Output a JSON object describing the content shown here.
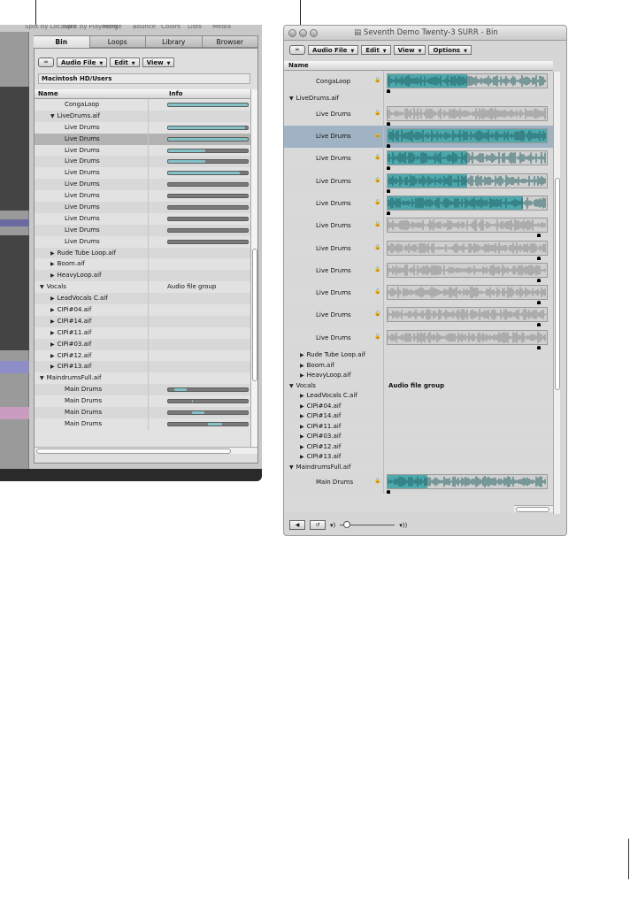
{
  "left_panel": {
    "top_menu": [
      "Split by Locators",
      "Split by Playhead",
      "Merge",
      "Bounce",
      "Colors",
      "Lists",
      "Media"
    ],
    "tabs": [
      "Bin",
      "Loops",
      "Library",
      "Browser"
    ],
    "toolbar": {
      "link_icon": "link-icon",
      "menus": [
        "Audio File",
        "Edit",
        "View"
      ]
    },
    "path": "Macintosh HD/Users",
    "columns": {
      "name": "Name",
      "info": "Info"
    },
    "rows": [
      {
        "name": "CongaLoop",
        "indent": 2,
        "tri": "",
        "bar": 1.0,
        "fill": 1.0
      },
      {
        "name": "LiveDrums.aif",
        "indent": 1,
        "tri": "open"
      },
      {
        "name": "Live Drums",
        "indent": 2,
        "tri": "",
        "bar": 1.0,
        "fill": 0.97
      },
      {
        "name": "Live Drums",
        "indent": 2,
        "tri": "",
        "bar": 1.0,
        "fill": 1.0,
        "selected": true
      },
      {
        "name": "Live Drums",
        "indent": 2,
        "tri": "",
        "bar": 1.0,
        "fill": 0.47
      },
      {
        "name": "Live Drums",
        "indent": 2,
        "tri": "",
        "bar": 1.0,
        "fill": 0.47
      },
      {
        "name": "Live Drums",
        "indent": 2,
        "tri": "",
        "bar": 1.0,
        "fill": 0.9
      },
      {
        "name": "Live Drums",
        "indent": 2,
        "tri": "",
        "bar": 1.0,
        "fill": 0
      },
      {
        "name": "Live Drums",
        "indent": 2,
        "tri": "",
        "bar": 1.0,
        "fill": 0
      },
      {
        "name": "Live Drums",
        "indent": 2,
        "tri": "",
        "bar": 1.0,
        "fill": 0
      },
      {
        "name": "Live Drums",
        "indent": 2,
        "tri": "",
        "bar": 1.0,
        "fill": 0
      },
      {
        "name": "Live Drums",
        "indent": 2,
        "tri": "",
        "bar": 1.0,
        "fill": 0
      },
      {
        "name": "Live Drums",
        "indent": 2,
        "tri": "",
        "bar": 1.0,
        "fill": 0
      },
      {
        "name": "Rude Tube Loop.aif",
        "indent": 1,
        "tri": "closed"
      },
      {
        "name": "Boom.aif",
        "indent": 1,
        "tri": "closed"
      },
      {
        "name": "HeavyLoop.aif",
        "indent": 1,
        "tri": "closed"
      },
      {
        "name": "Vocals",
        "indent": 0,
        "tri": "open",
        "info": "Audio file group"
      },
      {
        "name": "LeadVocals C.aif",
        "indent": 1,
        "tri": "closed"
      },
      {
        "name": "CIPi#04.aif",
        "indent": 1,
        "tri": "closed"
      },
      {
        "name": "CIPi#14.aif",
        "indent": 1,
        "tri": "closed"
      },
      {
        "name": "CIPi#11.aif",
        "indent": 1,
        "tri": "closed"
      },
      {
        "name": "CIPi#03.aif",
        "indent": 1,
        "tri": "closed"
      },
      {
        "name": "CIPi#12.aif",
        "indent": 1,
        "tri": "closed"
      },
      {
        "name": "CIPi#13.aif",
        "indent": 1,
        "tri": "closed"
      },
      {
        "name": "MaindrumsFull.aif",
        "indent": 0,
        "tri": "open"
      },
      {
        "name": "Main Drums",
        "indent": 2,
        "tri": "",
        "bar": 1.0,
        "fill": 0.15,
        "fill_start": 0.08
      },
      {
        "name": "Main Drums",
        "indent": 2,
        "tri": "",
        "bar": 1.0,
        "fill": 0.01,
        "fill_start": 0.3
      },
      {
        "name": "Main Drums",
        "indent": 2,
        "tri": "",
        "bar": 1.0,
        "fill": 0.15,
        "fill_start": 0.3
      },
      {
        "name": "Main Drums",
        "indent": 2,
        "tri": "",
        "bar": 1.0,
        "fill": 0.18,
        "fill_start": 0.5
      }
    ]
  },
  "right_window": {
    "title": "Seventh Demo Twenty-3 SURR - Bin",
    "toolbar": {
      "link_icon": "link-icon",
      "menus": [
        "Audio File",
        "Edit",
        "View",
        "Options"
      ]
    },
    "columns": {
      "name": "Name"
    },
    "rows": [
      {
        "name": "CongaLoop",
        "type": "wave",
        "region": 0.5,
        "lock": true
      },
      {
        "name": "LiveDrums.aif",
        "type": "folder",
        "tri": "open",
        "indent": 0
      },
      {
        "name": "Live Drums",
        "type": "wave",
        "region": 0,
        "lock": true
      },
      {
        "name": "Live Drums",
        "type": "wave",
        "region": 1.0,
        "lock": true,
        "selected": true
      },
      {
        "name": "Live Drums",
        "type": "wave",
        "region": 0.5,
        "lock": true
      },
      {
        "name": "Live Drums",
        "type": "wave",
        "region": 0.5,
        "lock": true
      },
      {
        "name": "Live Drums",
        "type": "wave",
        "region": 0.85,
        "lock": true
      },
      {
        "name": "Live Drums",
        "type": "wave",
        "region": 0,
        "lock": true
      },
      {
        "name": "Live Drums",
        "type": "wave",
        "region": 0,
        "lock": true
      },
      {
        "name": "Live Drums",
        "type": "wave",
        "region": 0,
        "lock": true
      },
      {
        "name": "Live Drums",
        "type": "wave",
        "region": 0,
        "lock": true
      },
      {
        "name": "Live Drums",
        "type": "wave",
        "region": 0,
        "lock": true
      },
      {
        "name": "Live Drums",
        "type": "wave",
        "region": 0,
        "lock": true
      },
      {
        "name": "Rude Tube Loop.aif",
        "type": "folder",
        "tri": "closed",
        "indent": 1
      },
      {
        "name": "Boom.aif",
        "type": "folder",
        "tri": "closed",
        "indent": 1
      },
      {
        "name": "HeavyLoop.aif",
        "type": "folder",
        "tri": "closed",
        "indent": 1
      },
      {
        "name": "Vocals",
        "type": "folder",
        "tri": "open",
        "indent": 0,
        "info": "Audio file group"
      },
      {
        "name": "LeadVocals C.aif",
        "type": "folder",
        "tri": "closed",
        "indent": 1
      },
      {
        "name": "CIPi#04.aif",
        "type": "folder",
        "tri": "closed",
        "indent": 1
      },
      {
        "name": "CIPi#14.aif",
        "type": "folder",
        "tri": "closed",
        "indent": 1
      },
      {
        "name": "CIPi#11.aif",
        "type": "folder",
        "tri": "closed",
        "indent": 1
      },
      {
        "name": "CIPi#03.aif",
        "type": "folder",
        "tri": "closed",
        "indent": 1
      },
      {
        "name": "CIPi#12.aif",
        "type": "folder",
        "tri": "closed",
        "indent": 1
      },
      {
        "name": "CIPi#13.aif",
        "type": "folder",
        "tri": "closed",
        "indent": 1
      },
      {
        "name": "MaindrumsFull.aif",
        "type": "folder",
        "tri": "open",
        "indent": 0
      },
      {
        "name": "Main Drums",
        "type": "wave",
        "region": 0.25,
        "lock": true
      }
    ]
  },
  "colors": {
    "region": "#4ea9ad",
    "bar_fill": "#84c2c8",
    "wave_gray": "#8a8a8a",
    "wave_dark": "#1f5f63"
  }
}
